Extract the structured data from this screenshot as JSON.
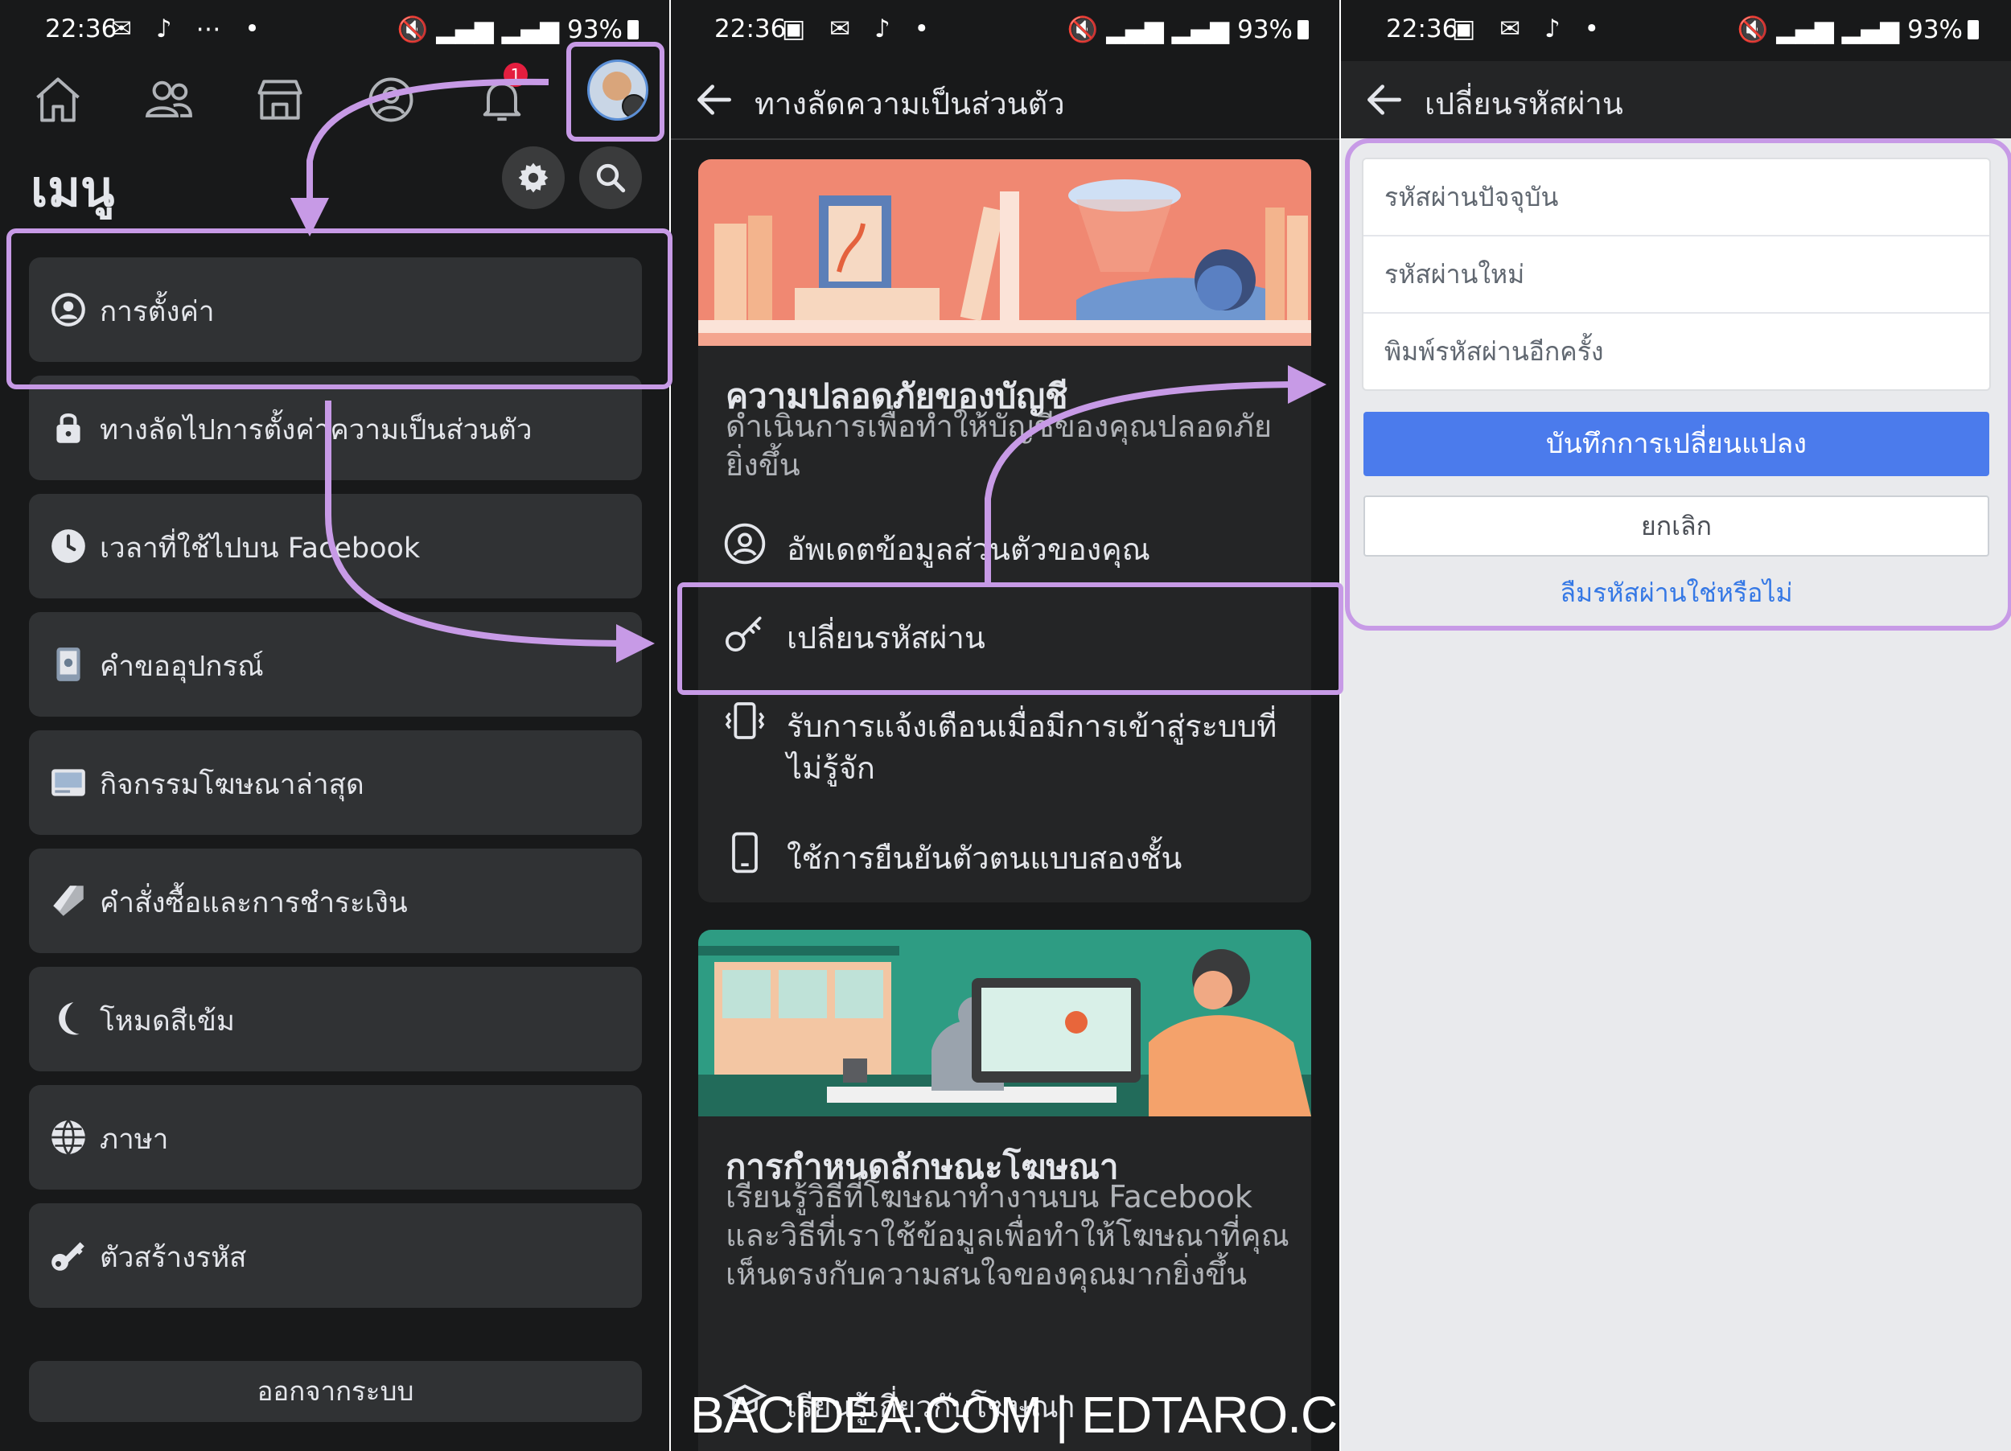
{
  "status_bar": {
    "time": "22:36",
    "battery": "93%",
    "icons": [
      "whatsapp-icon",
      "tiktok-icon",
      "wifi-icon",
      "signal-icon",
      "mute-icon",
      "battery-icon"
    ]
  },
  "panel1": {
    "menu_title": "เมนู",
    "notification_count": "1",
    "items": [
      {
        "label": "การตั้งค่า",
        "icon": "profile-icon"
      },
      {
        "label": "ทางลัดไปการตั้งค่าความเป็นส่วนตัว",
        "icon": "lock-icon"
      },
      {
        "label": "เวลาที่ใช้ไปบน Facebook",
        "icon": "clock-icon"
      },
      {
        "label": "คำขออุปกรณ์",
        "icon": "device-icon"
      },
      {
        "label": "กิจกรรมโฆษณาล่าสุด",
        "icon": "ad-icon"
      },
      {
        "label": "คำสั่งซื้อและการชำระเงิน",
        "icon": "tag-icon"
      },
      {
        "label": "โหมดสีเข้ม",
        "icon": "moon-icon"
      },
      {
        "label": "ภาษา",
        "icon": "globe-icon"
      },
      {
        "label": "ตัวสร้างรหัส",
        "icon": "key-icon"
      }
    ],
    "logout_label": "ออกจากระบบ"
  },
  "panel2": {
    "title": "ทางลัดความเป็นส่วนตัว",
    "security_card": {
      "title": "ความปลอดภัยของบัญชี",
      "desc": "ดำเนินการเพื่อทำให้บัญชีของคุณปลอดภัยยิ่งขึ้น",
      "rows": [
        {
          "label": "อัพเดตข้อมูลส่วนตัวของคุณ",
          "icon": "profile-icon"
        },
        {
          "label": "เปลี่ยนรหัสผ่าน",
          "icon": "key-icon"
        },
        {
          "label": "รับการแจ้งเตือนเมื่อมีการเข้าสู่ระบบที่",
          "label2": "ไม่รู้จัก",
          "icon": "vibrate-icon"
        },
        {
          "label": "ใช้การยืนยันตัวตนแบบสองชั้น",
          "icon": "phone-icon"
        }
      ]
    },
    "ads_card": {
      "title": "การกำหนดลักษณะโฆษณา",
      "desc": "เรียนรู้วิธีที่โฆษณาทำงานบน Facebook และวิธีที่เราใช้ข้อมูลเพื่อทำให้โฆษณาที่คุณเห็นตรงกับความสนใจของคุณมากยิ่งขึ้น",
      "row": "เรียนรู้เกี่ยวกับโฆษณา"
    },
    "watermark": "BACIDEA.COM | EDTARO.COM"
  },
  "panel3": {
    "title": "เปลี่ยนรหัสผ่าน",
    "fields": [
      {
        "placeholder": "รหัสผ่านปัจจุบัน",
        "value": ""
      },
      {
        "placeholder": "รหัสผ่านใหม่",
        "value": ""
      },
      {
        "placeholder": "พิมพ์รหัสผ่านอีกครั้ง",
        "value": ""
      }
    ],
    "save_label": "บันทึกการเปลี่ยนแปลง",
    "cancel_label": "ยกเลิก",
    "forgot_label": "ลืมรหัสผ่านใช่หรือไม่"
  },
  "colors": {
    "dark_bg": "#18191a",
    "card_bg": "#303234",
    "primary_blue": "#4b7bec",
    "link_blue": "#3578e5",
    "highlight": "#c79ae6"
  }
}
